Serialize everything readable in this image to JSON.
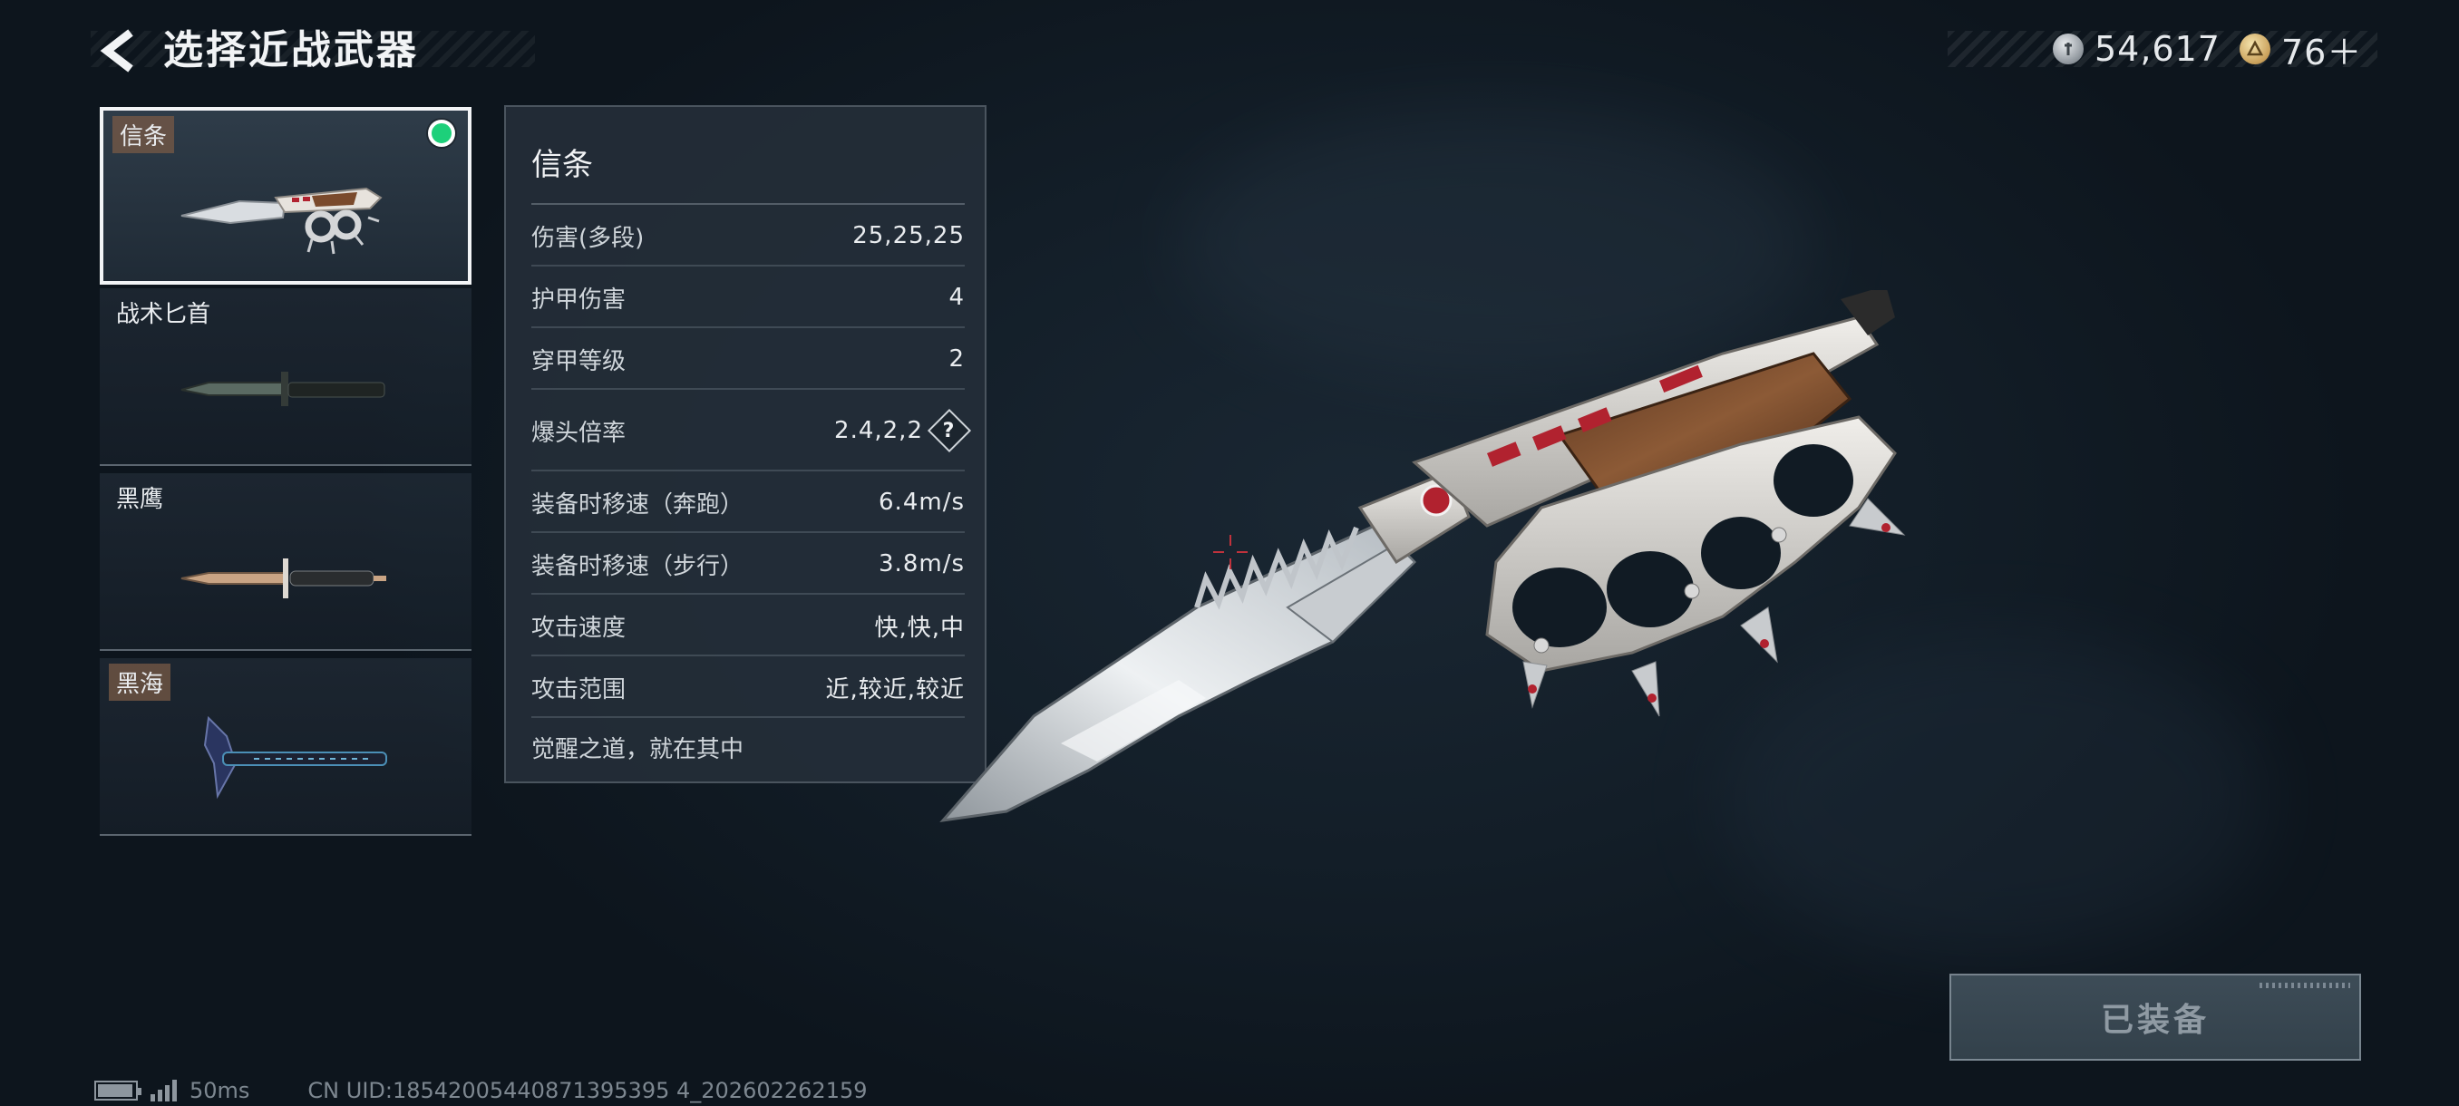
{
  "header": {
    "title": "选择近战武器"
  },
  "currency": {
    "silver": "54,617",
    "gold": "76＋"
  },
  "weapons": [
    {
      "name": "信条",
      "selected": true,
      "equipped": true,
      "tagged": true
    },
    {
      "name": "战术匕首",
      "selected": false,
      "equipped": false,
      "tagged": false
    },
    {
      "name": "黑鹰",
      "selected": false,
      "equipped": false,
      "tagged": false
    },
    {
      "name": "黑海",
      "selected": false,
      "equipped": false,
      "tagged": true
    }
  ],
  "stats": {
    "title": "信条",
    "rows": [
      {
        "label": "伤害(多段)",
        "value": "25,25,25"
      },
      {
        "label": "护甲伤害",
        "value": "4"
      },
      {
        "label": "穿甲等级",
        "value": "2"
      },
      {
        "label": "爆头倍率",
        "value": "2.4,2,2"
      },
      {
        "label": "装备时移速（奔跑）",
        "value": "6.4m/s"
      },
      {
        "label": "装备时移速（步行）",
        "value": "3.8m/s"
      },
      {
        "label": "攻击速度",
        "value": "快,快,中"
      },
      {
        "label": "攻击范围",
        "value": "近,较近,较近"
      }
    ],
    "help_glyph": "?",
    "quote": "觉醒之道，就在其中"
  },
  "equip_button": {
    "label": "已装备"
  },
  "footer": {
    "ping": "50ms",
    "uid": "CN UID:18542005440871395395 4_202602262159"
  },
  "colors": {
    "accent_equipped": "#1dd07a",
    "background": "#111b24"
  },
  "icons": {
    "back": "chevron-left-icon",
    "silver_coin": "silver-coin-icon",
    "gold_coin": "gold-coin-icon",
    "help": "question-diamond-icon",
    "battery": "battery-icon",
    "signal": "signal-icon"
  }
}
